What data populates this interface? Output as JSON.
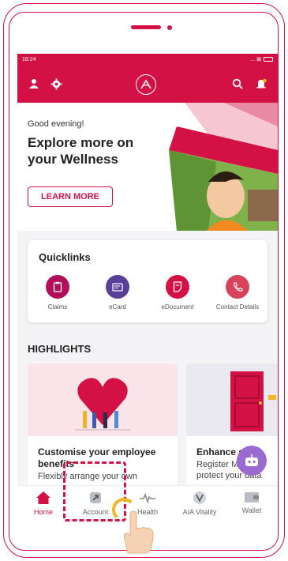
{
  "status_bar": {
    "time": "18:24",
    "indicators": "... ⊠"
  },
  "header": {
    "left_icons": [
      "profile-icon",
      "settings-icon"
    ],
    "logo": "AIA",
    "right_icons": [
      "search-icon",
      "notification-bell-icon"
    ],
    "accent_color": "#d31145"
  },
  "banner": {
    "greeting": "Good evening!",
    "title": "Explore more on your Wellness",
    "button_label": "LEARN MORE"
  },
  "quicklinks": {
    "title": "Quicklinks",
    "items": [
      {
        "label": "Claims",
        "icon": "clipboard-icon",
        "color": "#b0105a"
      },
      {
        "label": "eCard",
        "icon": "card-icon",
        "color": "#5a3f99"
      },
      {
        "label": "eDocument",
        "icon": "document-icon",
        "color": "#d31145"
      },
      {
        "label": "Contact Details",
        "icon": "phone-icon",
        "color": "#d8425a"
      }
    ]
  },
  "highlights": {
    "title": "HIGHLIGHTS",
    "cards": [
      {
        "title": "Customise your employee benefits",
        "desc": "Flexibly arrange your own"
      },
      {
        "title": "Enhance s",
        "desc": "Register M to fu"
      }
    ],
    "card2_desc2": "protect your data"
  },
  "bottom_nav": {
    "items": [
      {
        "label": "Home",
        "icon": "home-icon",
        "active": true
      },
      {
        "label": "Account",
        "icon": "account-shield-icon",
        "active": false
      },
      {
        "label": "Health",
        "icon": "heartbeat-icon",
        "active": false
      },
      {
        "label": "AIA Vitality",
        "icon": "vitality-icon",
        "active": false
      },
      {
        "label": "Wallet",
        "icon": "wallet-icon",
        "active": false
      }
    ]
  }
}
